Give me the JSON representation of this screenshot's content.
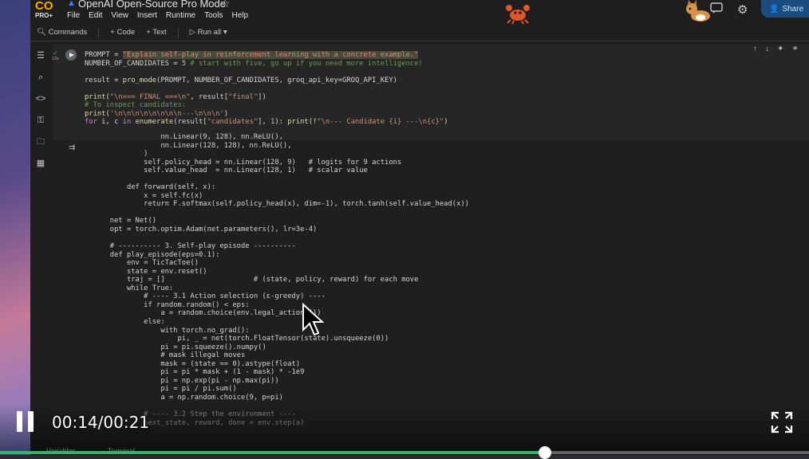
{
  "app": {
    "logo_text": "CO",
    "logo_sub": "PRO+",
    "title": "OpenAI Open-Source Pro Mode"
  },
  "menu": [
    "File",
    "Edit",
    "View",
    "Insert",
    "Runtime",
    "Tools",
    "Help"
  ],
  "header": {
    "share_label": "Share"
  },
  "toolbar": {
    "commands": "Commands",
    "code": "+ Code",
    "text": "+ Text",
    "run_all": "Run all"
  },
  "cell": {
    "status": "13s"
  },
  "player": {
    "time": "00:14/00:21",
    "progress": 0.674,
    "accent": "#35b46a"
  },
  "bottom_tabs": [
    "Variables",
    "Terminal"
  ],
  "icons": {
    "sidebar": [
      "toc-icon",
      "search-icon",
      "code-icon",
      "key-icon",
      "folder-icon",
      "calendar-icon"
    ]
  }
}
